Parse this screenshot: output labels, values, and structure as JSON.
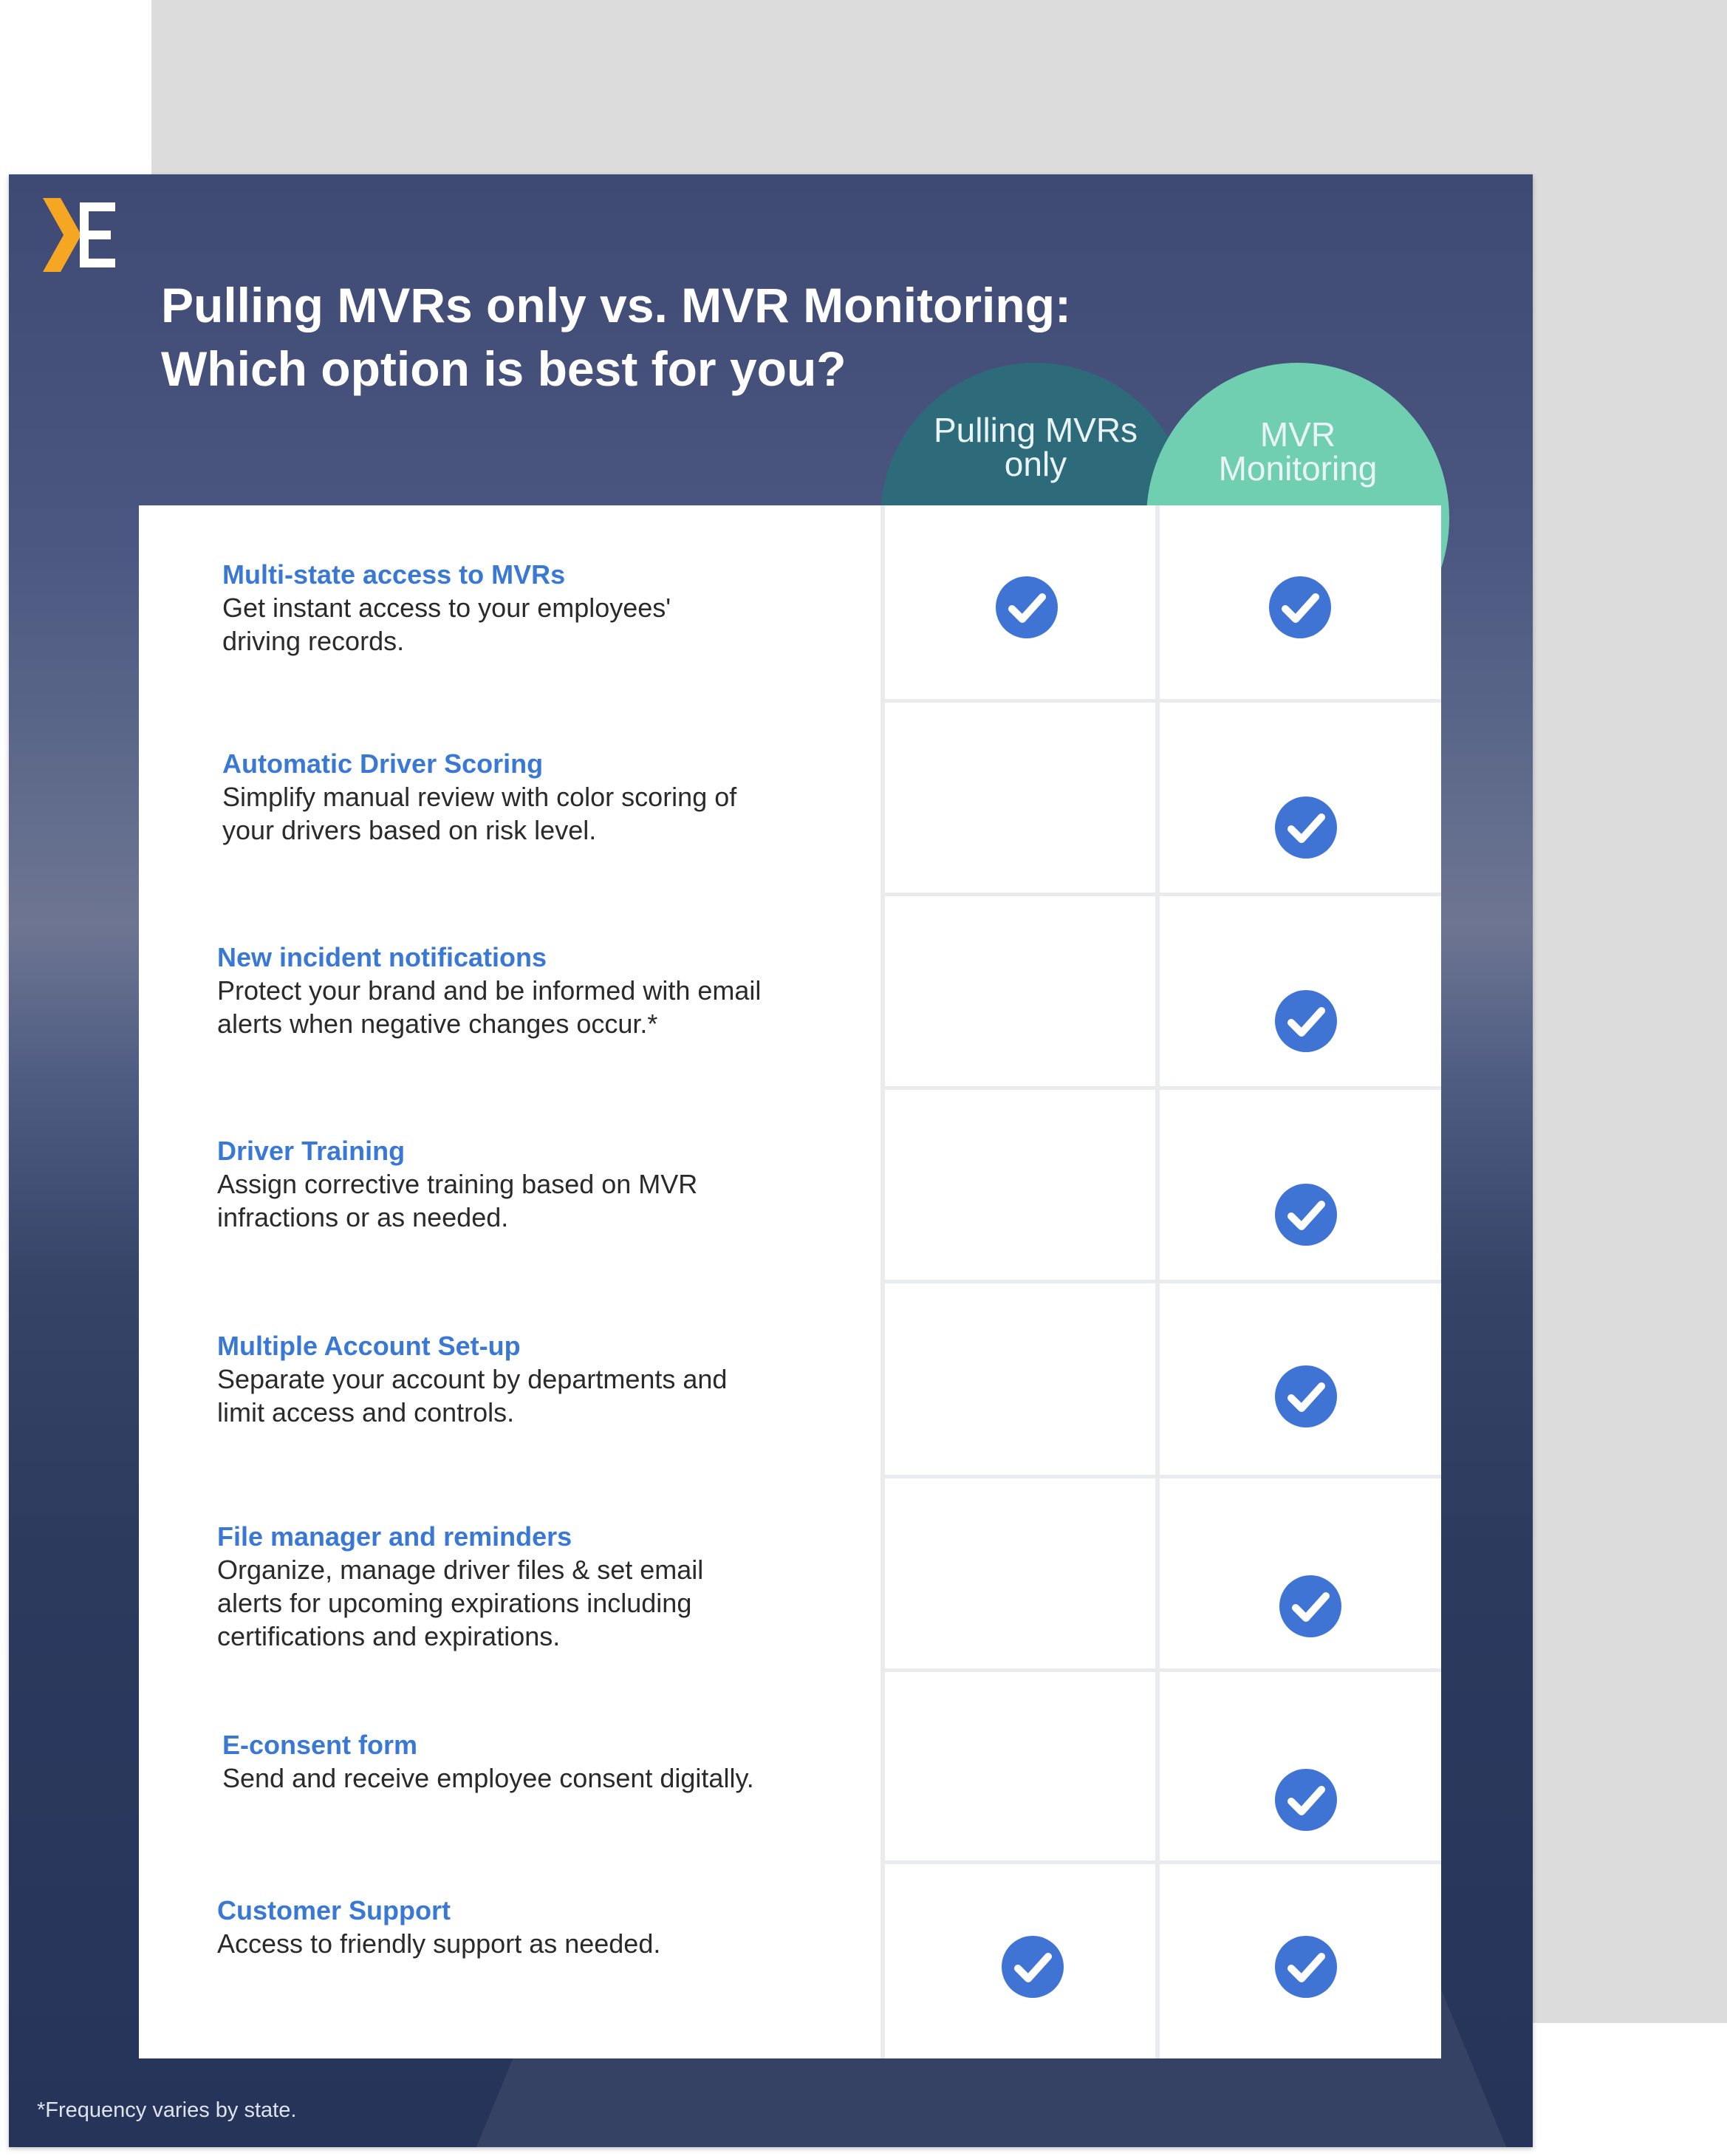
{
  "document": {
    "title_line1": "Pulling MVRs only vs. MVR Monitoring:",
    "title_line2": "Which option is best for you?",
    "footnote": "*Frequency varies by state."
  },
  "columns": {
    "pulling_line1": "Pulling MVRs",
    "pulling_line2": "only",
    "monitoring_line1": "MVR",
    "monitoring_line2": "Monitoring"
  },
  "colors": {
    "check": "#3f74d4",
    "feature_title": "#3a78d6",
    "pulling_header": "#2d6b7a",
    "monitoring_header": "#6fcfb0",
    "logo_accent": "#f5a623"
  },
  "features": [
    {
      "title": "Multi-state access to MVRs",
      "desc_line1": "Get instant access to your employees'",
      "desc_line2": "driving records.",
      "desc_line3": "",
      "pulling": true,
      "monitoring": true
    },
    {
      "title": "Automatic Driver Scoring",
      "desc_line1": "Simplify manual review with color scoring of",
      "desc_line2": "your drivers based on risk level.",
      "desc_line3": "",
      "pulling": false,
      "monitoring": true
    },
    {
      "title": "New incident notifications",
      "desc_line1": "Protect your brand and be informed with email",
      "desc_line2": "alerts when negative changes occur.*",
      "desc_line3": "",
      "pulling": false,
      "monitoring": true
    },
    {
      "title": "Driver Training",
      "desc_line1": "Assign corrective training based on MVR",
      "desc_line2": "infractions or as needed.",
      "desc_line3": "",
      "pulling": false,
      "monitoring": true
    },
    {
      "title": "Multiple Account Set-up",
      "desc_line1": "Separate your account by departments and",
      "desc_line2": "limit access and controls.",
      "desc_line3": "",
      "pulling": false,
      "monitoring": true
    },
    {
      "title": "File manager and reminders",
      "desc_line1": "Organize, manage driver files & set email",
      "desc_line2": "alerts for upcoming expirations including",
      "desc_line3": "certifications and expirations.",
      "pulling": false,
      "monitoring": true
    },
    {
      "title": "E-consent form",
      "desc_line1": "Send and receive employee consent digitally.",
      "desc_line2": "",
      "desc_line3": "",
      "pulling": false,
      "monitoring": true
    },
    {
      "title": "Customer Support",
      "desc_line1": "Access to friendly support as needed.",
      "desc_line2": "",
      "desc_line3": "",
      "pulling": true,
      "monitoring": true
    }
  ]
}
